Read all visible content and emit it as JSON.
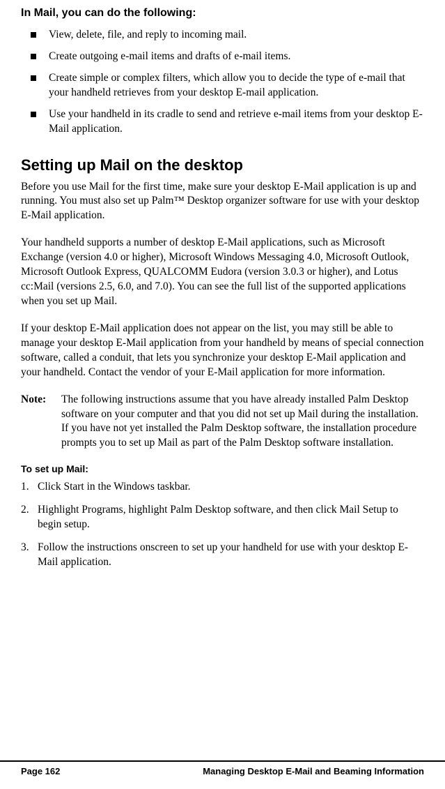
{
  "intro_heading": "In Mail, you can do the following:",
  "bullets": {
    "b0": "View, delete, file, and reply to incoming mail.",
    "b1": "Create outgoing e-mail items and drafts of e-mail items.",
    "b2": "Create simple or complex filters, which allow you to decide the type of e-mail that your handheld retrieves from your desktop E-mail application.",
    "b3": "Use your handheld in its cradle to send and retrieve e-mail items from your desktop E-Mail application."
  },
  "section_heading": "Setting up Mail on the desktop",
  "para1": "Before you use Mail for the first time, make sure your desktop E-Mail application is up and running. You must also set up Palm™ Desktop organizer software for use with your desktop E-Mail application.",
  "para2": "Your handheld supports a number of desktop E-Mail applications, such as Microsoft Exchange (version 4.0 or higher), Microsoft Windows Messaging 4.0, Microsoft Outlook, Microsoft Outlook Express, QUALCOMM Eudora (version 3.0.3 or higher), and Lotus cc:Mail (versions 2.5, 6.0, and 7.0). You can see the full list of the supported applications when you set up Mail.",
  "para3": "If your desktop E-Mail application does not appear on the list, you may still be able to manage your desktop E-Mail application from your handheld by means of special connection software, called a conduit, that lets you synchronize your desktop E-Mail application and your handheld. Contact the vendor of your E-Mail application for more information.",
  "note_label": "Note:",
  "note_body": "The following instructions assume that you have already installed Palm Desktop software on your computer and that you did not set up Mail during the installation. If you have not yet installed the Palm Desktop software, the installation procedure prompts you to set up Mail as part of the Palm Desktop software installation.",
  "procedure_heading": "To set up Mail:",
  "steps": {
    "s1_num": "1.",
    "s1_txt": "Click Start in the Windows taskbar.",
    "s2_num": "2.",
    "s2_txt": "Highlight Programs, highlight Palm Desktop software, and then click Mail Setup to begin setup.",
    "s3_num": "3.",
    "s3_txt": "Follow the instructions onscreen to set up your handheld for use with your desktop E-Mail application."
  },
  "footer_left": "Page 162",
  "footer_right": "Managing Desktop E-Mail and Beaming Information"
}
